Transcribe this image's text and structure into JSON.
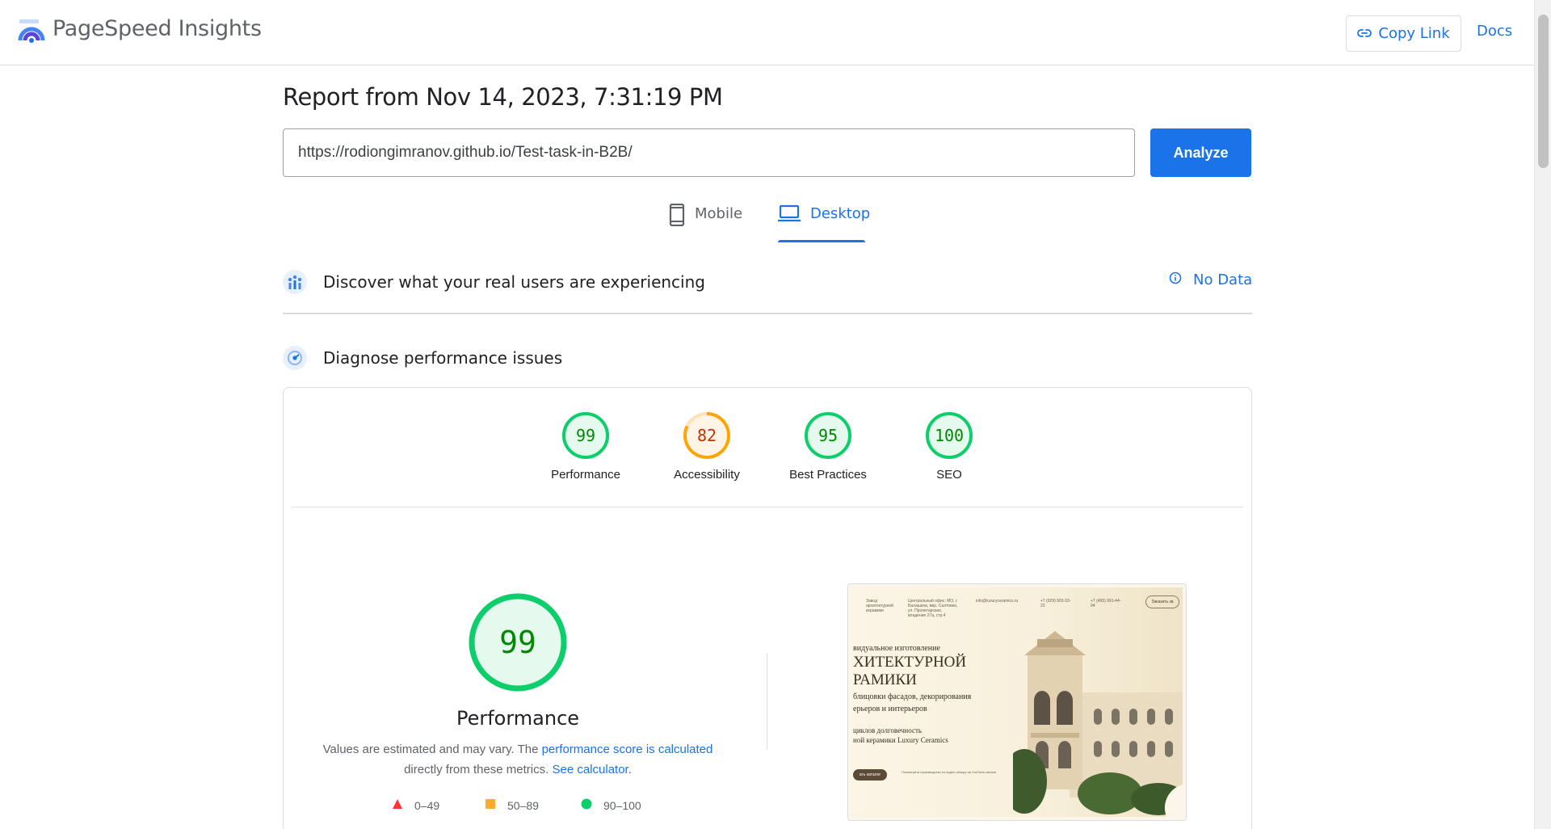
{
  "header": {
    "brand": "PageSpeed Insights",
    "copy_link_label": "Copy Link",
    "docs_label": "Docs"
  },
  "report": {
    "title": "Report from Nov 14, 2023, 7:31:19 PM",
    "url_value": "https://rodiongimranov.github.io/Test-task-in-B2B/",
    "analyze_label": "Analyze"
  },
  "tabs": [
    {
      "label": "Mobile",
      "icon": "phone-icon",
      "active": false
    },
    {
      "label": "Desktop",
      "icon": "laptop-icon",
      "active": true
    }
  ],
  "field_data": {
    "title": "Discover what your real users are experiencing",
    "status": "No Data"
  },
  "diagnose": {
    "title": "Diagnose performance issues"
  },
  "scores": [
    {
      "label": "Performance",
      "value": 99,
      "grade": "pass"
    },
    {
      "label": "Accessibility",
      "value": 82,
      "grade": "average"
    },
    {
      "label": "Best Practices",
      "value": 95,
      "grade": "pass"
    },
    {
      "label": "SEO",
      "value": 100,
      "grade": "pass"
    }
  ],
  "performance": {
    "score": 99,
    "title": "Performance",
    "desc_pre": "Values are estimated and may vary. The ",
    "desc_link1": "performance score is calculated",
    "desc_mid": "directly from these metrics. ",
    "desc_link2": "See calculator."
  },
  "legend": [
    {
      "label": "0–49",
      "shape": "triangle",
      "color": "#ff3333"
    },
    {
      "label": "50–89",
      "shape": "square",
      "color": "#ffaa33"
    },
    {
      "label": "90–100",
      "shape": "circle",
      "color": "#0cce6b"
    }
  ],
  "colors": {
    "accent": "#1a73e8",
    "pass": "#0cce6b",
    "pass_text": "#008800",
    "pass_bg": "#e6f9ee",
    "average": "#ffa400",
    "average_text": "#c33300",
    "average_bg": "#fff4e5"
  },
  "screenshot": {
    "nav": [
      "Завод архитектурной керамики",
      "Центральный офис: МО, г. Балашиха, мкр. Салтовка, ул. Пролетарская, владение 27а, стр.4",
      "info@luxuryceramics.ru",
      "+7 (929) 903-33-22",
      "+7 (495) 991-44-04"
    ],
    "cta": "Заказать зв",
    "line1": "видуальное изготовление",
    "line2": "ХИТЕКТУРНОЙ",
    "line3": "РАМИКИ",
    "line4": "блицовки фасадов, декорирования",
    "line5": "ерьеров и интерьеров",
    "line6": "циклов долговечность",
    "line7": "ной керамики Luxury Ceramics",
    "button": "ать каталог",
    "small": "Посмотрите производство по видео-обзору на YouTube-канале"
  }
}
